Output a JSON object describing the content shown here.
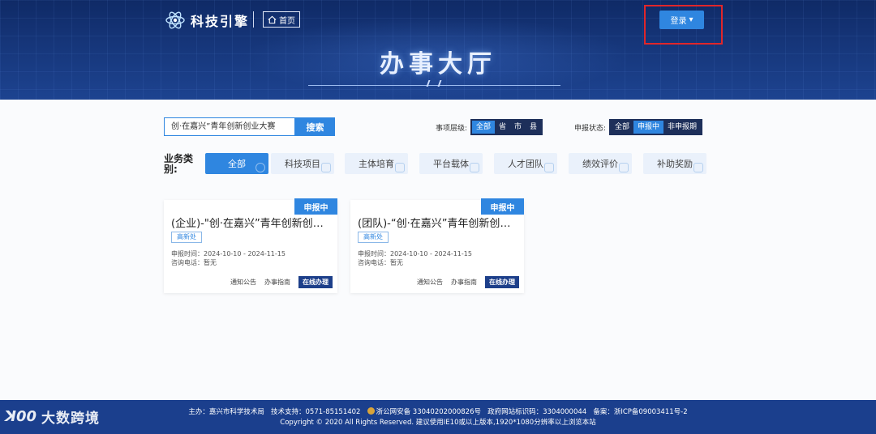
{
  "header": {
    "logo_text": "科技引擎",
    "home_label": "首页",
    "login_label": "登录",
    "hall_title": "办事大厅"
  },
  "search": {
    "value": "创·在嘉兴”青年创新创业大赛",
    "button_label": "搜索"
  },
  "filters": {
    "level": {
      "label": "事项层级:",
      "options": [
        "全部",
        "省",
        "市",
        "县"
      ],
      "selected": "全部"
    },
    "status": {
      "label": "申报状态:",
      "options": [
        "全部",
        "申报中",
        "非申报期"
      ],
      "selected": "申报中"
    }
  },
  "categories": {
    "label": "业务类别:",
    "items": [
      "全部",
      "科技项目",
      "主体培育",
      "平台载体",
      "人才团队",
      "绩效评价",
      "补助奖励"
    ],
    "selected": "全部"
  },
  "cards": [
    {
      "badge": "申报中",
      "title": "(企业)-\"创·在嘉兴”青年创新创业大赛",
      "dept": "高新处",
      "date": "申报时间：2024-10-10 - 2024-11-15",
      "phone": "咨询电话：暂无",
      "notice": "通知公告",
      "guide": "办事指南",
      "apply": "在线办理"
    },
    {
      "badge": "申报中",
      "title": "(团队)-“创·在嘉兴”青年创新创业大赛",
      "dept": "高新处",
      "date": "申报时间：2024-10-10 - 2024-11-15",
      "phone": "咨询电话：暂无",
      "notice": "通知公告",
      "guide": "办事指南",
      "apply": "在线办理"
    }
  ],
  "footer": {
    "line1_host": "主办：嘉兴市科学技术局",
    "line1_support": "技术支持：0571-85151402",
    "line1_police": "浙公网安备 33040202000826号",
    "line1_site": "政府网站标识码：3304000044",
    "line1_icp": "备案：浙ICP备09003411号-2",
    "line2": "Copyright © 2020 All Rights Reserved.   建议使用IE10或以上版本,1920*1080分辨率以上浏览本站"
  },
  "watermark": {
    "logo": "ꓘ00",
    "text": "大数跨境"
  },
  "colors": {
    "primary": "#2f86e0",
    "header_bg": "#16367a",
    "footer_bg": "#1b3f8d",
    "highlight_frame": "#e0262a"
  }
}
